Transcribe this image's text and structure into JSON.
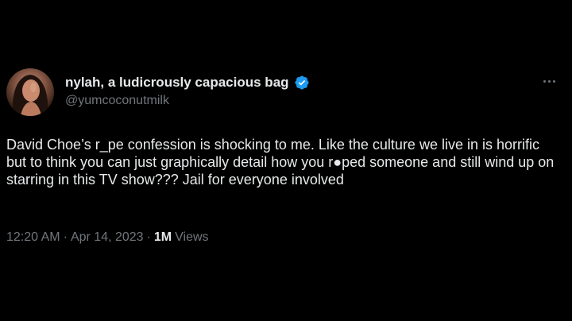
{
  "author": {
    "display_name": "nylah, a ludicrously capacious bag",
    "handle": "@yumcoconutmilk",
    "verified": true,
    "verified_color": "#1d9bf0"
  },
  "tweet": {
    "text": "David Choe’s r_pe confession is shocking to me. Like the culture we live in is horrific but to think you can just graphically detail how you r●ped someone and still wind up on starring in this TV show??? Jail for everyone involved"
  },
  "meta": {
    "time": "12:20 AM",
    "separator": "·",
    "date": "Apr 14, 2023",
    "views_count": "1M",
    "views_label": "Views"
  },
  "icons": {
    "avatar": "profile-photo",
    "verified": "verified-badge-icon",
    "more": "more-options-icon"
  },
  "colors": {
    "background": "#000000",
    "text_primary": "#e7e9ea",
    "text_secondary": "#71767b",
    "accent": "#1d9bf0"
  }
}
